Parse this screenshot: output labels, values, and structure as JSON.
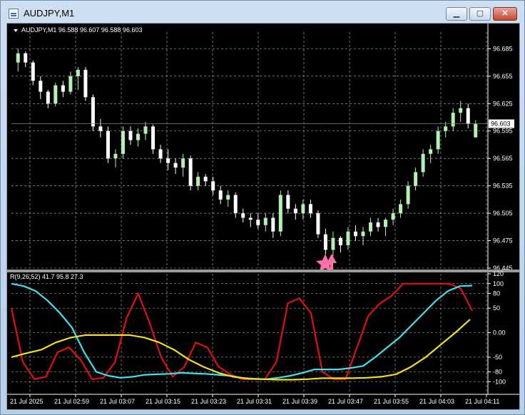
{
  "window": {
    "title": "AUDJPY,M1",
    "buttons": {
      "minimize": "▁",
      "maximize": "▢",
      "close": "✕"
    }
  },
  "chart_info": {
    "symbol_line": "AUDJPY,M1  96.588 96.607 96.588 96.603"
  },
  "indicator": {
    "label": "R(9,26,52) 41.7 95.8 27.3"
  },
  "colors": {
    "background": "#000000",
    "grid": "#c0c0c0",
    "bull_candle": "#b4f0b4",
    "bear_candle": "#ffffff",
    "line_red": "#e01010",
    "line_cyan": "#40e0f0",
    "line_yellow": "#f0e020",
    "arrow": "#ff6fa8",
    "text": "#ffffff"
  },
  "chart_data": [
    {
      "type": "candlestick",
      "price_ticks": [
        "96.685",
        "96.655",
        "96.625",
        "96.595",
        "96.565",
        "96.535",
        "96.505",
        "96.475",
        "96.445"
      ],
      "current_price": "96.603",
      "ylim": [
        96.445,
        96.697
      ],
      "candles": [
        [
          96.67,
          96.685,
          96.66,
          96.68
        ],
        [
          96.68,
          96.682,
          96.665,
          96.67
        ],
        [
          96.67,
          96.672,
          96.645,
          96.65
        ],
        [
          96.65,
          96.655,
          96.63,
          96.638
        ],
        [
          96.638,
          96.64,
          96.62,
          96.625
        ],
        [
          96.625,
          96.648,
          96.622,
          96.645
        ],
        [
          96.645,
          96.65,
          96.632,
          96.638
        ],
        [
          96.638,
          96.66,
          96.635,
          96.655
        ],
        [
          96.655,
          96.665,
          96.64,
          96.662
        ],
        [
          96.662,
          96.665,
          96.628,
          96.632
        ],
        [
          96.632,
          96.635,
          96.595,
          96.6
        ],
        [
          96.6,
          96.608,
          96.588,
          96.595
        ],
        [
          96.595,
          96.6,
          96.56,
          96.565
        ],
        [
          96.565,
          96.575,
          96.555,
          96.57
        ],
        [
          96.57,
          96.6,
          96.565,
          96.595
        ],
        [
          96.595,
          96.6,
          96.58,
          96.585
        ],
        [
          96.585,
          96.598,
          96.578,
          96.592
        ],
        [
          96.592,
          96.605,
          96.585,
          96.6
        ],
        [
          96.6,
          96.602,
          96.57,
          96.575
        ],
        [
          96.575,
          96.58,
          96.56,
          96.565
        ],
        [
          96.565,
          96.575,
          96.552,
          96.56
        ],
        [
          96.56,
          96.565,
          96.548,
          96.555
        ],
        [
          96.555,
          96.57,
          96.545,
          96.565
        ],
        [
          96.565,
          96.568,
          96.53,
          96.535
        ],
        [
          96.535,
          96.55,
          96.53,
          96.545
        ],
        [
          96.545,
          96.548,
          96.535,
          96.54
        ],
        [
          96.54,
          96.545,
          96.525,
          96.53
        ],
        [
          96.53,
          96.535,
          96.515,
          96.52
        ],
        [
          96.52,
          96.53,
          96.512,
          96.525
        ],
        [
          96.525,
          96.528,
          96.5,
          96.505
        ],
        [
          96.505,
          96.51,
          96.495,
          96.5
        ],
        [
          96.5,
          96.505,
          96.49,
          96.498
        ],
        [
          96.498,
          96.505,
          96.488,
          96.492
        ],
        [
          96.492,
          96.505,
          96.485,
          96.5
        ],
        [
          96.5,
          96.505,
          96.478,
          96.485
        ],
        [
          96.485,
          96.53,
          96.48,
          96.525
        ],
        [
          96.525,
          96.53,
          96.505,
          96.51
        ],
        [
          96.51,
          96.515,
          96.498,
          96.505
        ],
        [
          96.505,
          96.52,
          96.498,
          96.515
        ],
        [
          96.515,
          96.52,
          96.5,
          96.505
        ],
        [
          96.505,
          96.508,
          96.478,
          96.482
        ],
        [
          96.482,
          96.488,
          96.46,
          96.465
        ],
        [
          96.465,
          96.485,
          96.458,
          96.478
        ],
        [
          96.478,
          96.48,
          96.462,
          96.47
        ],
        [
          96.47,
          96.49,
          96.465,
          96.485
        ],
        [
          96.485,
          96.492,
          96.475,
          96.48
        ],
        [
          96.48,
          96.49,
          96.47,
          96.485
        ],
        [
          96.485,
          96.5,
          96.48,
          96.495
        ],
        [
          96.495,
          96.5,
          96.485,
          96.49
        ],
        [
          96.49,
          96.5,
          96.48,
          96.498
        ],
        [
          96.498,
          96.51,
          96.492,
          96.505
        ],
        [
          96.505,
          96.52,
          96.5,
          96.515
        ],
        [
          96.515,
          96.54,
          96.51,
          96.535
        ],
        [
          96.535,
          96.555,
          96.53,
          96.55
        ],
        [
          96.55,
          96.575,
          96.545,
          96.57
        ],
        [
          96.57,
          96.58,
          96.56,
          96.575
        ],
        [
          96.575,
          96.6,
          96.57,
          96.595
        ],
        [
          96.595,
          96.605,
          96.588,
          96.6
        ],
        [
          96.6,
          96.62,
          96.595,
          96.615
        ],
        [
          96.615,
          96.628,
          96.605,
          96.62
        ],
        [
          96.62,
          96.625,
          96.598,
          96.603
        ],
        [
          96.588,
          96.607,
          96.588,
          96.603
        ]
      ],
      "x_labels": [
        "21 Jul 2025",
        "21 Jul 02:59",
        "21 Jul 03:07",
        "21 Jul 03:15",
        "21 Jul 03:23",
        "21 Jul 03:31",
        "21 Jul 03:39",
        "21 Jul 03:47",
        "21 Jul 03:55",
        "21 Jul 04:03",
        "21 Jul 04:11"
      ]
    },
    {
      "type": "line",
      "ylim": [
        -120,
        120
      ],
      "y_ticks": [
        "120",
        "100",
        "80",
        "50",
        "0.00",
        "-50",
        "-80",
        "-100"
      ],
      "series": [
        {
          "name": "R9",
          "color": "#e01010",
          "values": [
            50,
            -60,
            -95,
            -90,
            -40,
            -30,
            -55,
            -95,
            -92,
            -60,
            30,
            80,
            20,
            -50,
            -90,
            -70,
            -20,
            -30,
            -70,
            -85,
            -95,
            -95,
            -95,
            -60,
            60,
            70,
            40,
            -80,
            -95,
            -95,
            -30,
            35,
            60,
            75,
            100,
            100,
            100,
            100,
            100,
            90,
            45
          ]
        },
        {
          "name": "R26",
          "color": "#40e0f0",
          "values": [
            100,
            95,
            85,
            65,
            40,
            10,
            -40,
            -80,
            -88,
            -92,
            -90,
            -86,
            -85,
            -84,
            -82,
            -83,
            -84,
            -86,
            -88,
            -92,
            -94,
            -95,
            -92,
            -88,
            -82,
            -75,
            -75,
            -75,
            -72,
            -68,
            -50,
            -30,
            -10,
            15,
            40,
            65,
            85,
            95,
            96
          ]
        },
        {
          "name": "R52",
          "color": "#f0e020",
          "values": [
            -50,
            -42,
            -35,
            -20,
            -10,
            -5,
            -5,
            -5,
            -5,
            -10,
            -20,
            -35,
            -55,
            -70,
            -82,
            -90,
            -94,
            -95,
            -96,
            -96,
            -95,
            -93,
            -93,
            -93,
            -92,
            -90,
            -85,
            -70,
            -50,
            -25,
            0,
            27
          ]
        }
      ]
    }
  ]
}
